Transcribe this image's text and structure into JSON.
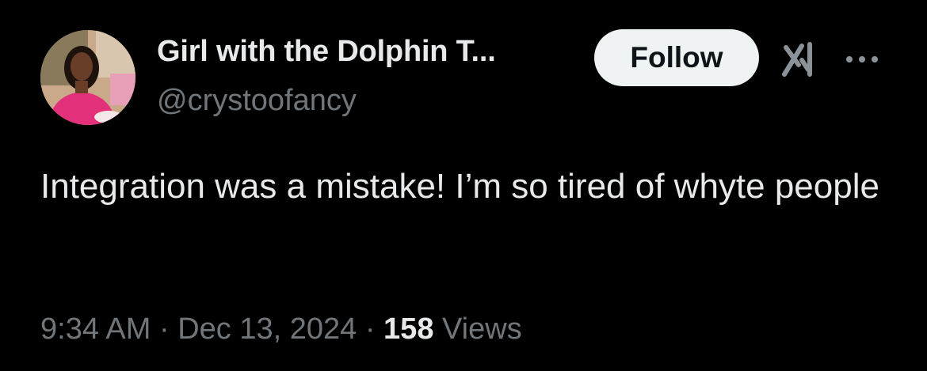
{
  "author": {
    "display_name": "Girl with the Dolphin T...",
    "handle": "@crystoofancy"
  },
  "actions": {
    "follow_label": "Follow",
    "grok_icon": "grok-icon",
    "more_icon": "more-dots-icon"
  },
  "tweet": {
    "text": "Integration was a mistake! I’m so tired of whyte people"
  },
  "meta": {
    "time": "9:34 AM",
    "separator": "·",
    "date": "Dec 13, 2024",
    "views_count": "158",
    "views_label": "Views"
  },
  "colors": {
    "background": "#000000",
    "primary_text": "#e7e9ea",
    "secondary_text": "#71767b",
    "follow_bg": "#eff3f4",
    "follow_text": "#0f1419"
  }
}
